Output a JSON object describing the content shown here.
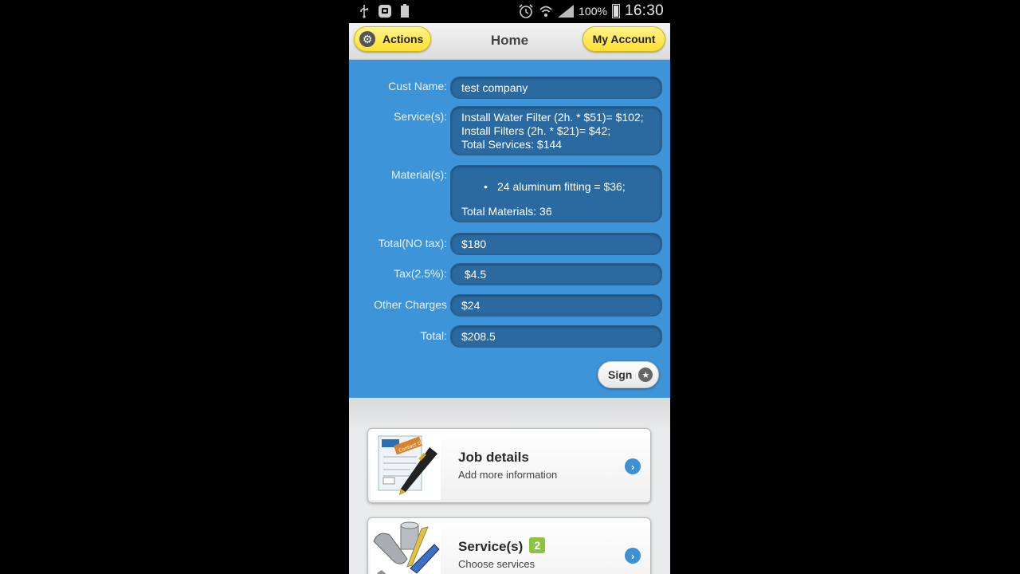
{
  "status_bar": {
    "battery_pct": "100%",
    "time": "16:30",
    "icons": [
      "usb-icon",
      "app-icon",
      "battery-small-icon",
      "alarm-icon",
      "wifi-icon",
      "signal-icon",
      "battery-icon"
    ]
  },
  "header": {
    "actions_label": "Actions",
    "title": "Home",
    "account_label": "My Account"
  },
  "form": {
    "cust_name": {
      "label": "Cust Name:",
      "value": "test company"
    },
    "services": {
      "label": "Service(s):",
      "lines": [
        "Install Water Filter (2h. * $51)= $102;",
        "Install Filters (2h. * $21)= $42;",
        "Total Services: $144"
      ]
    },
    "materials": {
      "label": "Material(s):",
      "items": [
        "24 aluminum fitting = $36;"
      ],
      "total": "Total Materials: 36"
    },
    "total_no_tax": {
      "label": "Total(NO tax):",
      "value": "$180"
    },
    "tax": {
      "label": "Tax(2.5%):",
      "value": " $4.5"
    },
    "other_charges": {
      "label": "Other Charges",
      "value": "$24"
    },
    "total": {
      "label": "Total:",
      "value": "$208.5"
    },
    "sign_label": "Sign"
  },
  "cards": [
    {
      "title": "Job details",
      "subtitle": "Add more information",
      "thumb_text": "Contact Details"
    },
    {
      "title": "Service(s)",
      "badge": "2",
      "subtitle": "Choose services"
    }
  ],
  "colors": {
    "panel_blue": "#3d94d9",
    "field_blue": "#2b6aa0",
    "header_yellow": "#ffdf33",
    "badge_green": "#8cc43f",
    "arrow_blue": "#3d8fd6"
  }
}
